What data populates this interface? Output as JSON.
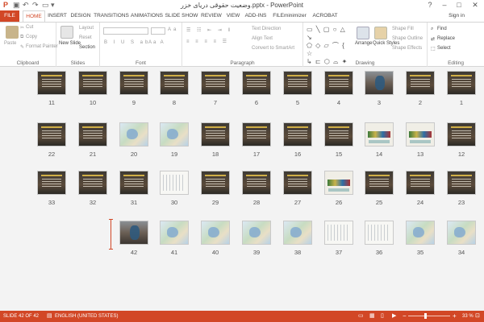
{
  "window": {
    "title": "وضعیت حقوقی دریای خزر.pptx - PowerPoint",
    "signin": "Sign in",
    "help": "?",
    "minimize": "–",
    "maximize": "□",
    "close": "✕"
  },
  "tabs": [
    "FILE",
    "HOME",
    "INSERT",
    "DESIGN",
    "TRANSITIONS",
    "ANIMATIONS",
    "SLIDE SHOW",
    "REVIEW",
    "VIEW",
    "ADD-INS",
    "FILEminimizer",
    "ACROBAT"
  ],
  "active_tab": "HOME",
  "ribbon": {
    "clipboard": {
      "label": "Clipboard",
      "paste": "Paste",
      "cut": "Cut",
      "copy": "Copy",
      "format_painter": "Format Painter"
    },
    "slides": {
      "label": "Slides",
      "new_slide": "New Slide",
      "layout": "Layout",
      "reset": "Reset",
      "section": "Section"
    },
    "font": {
      "label": "Font"
    },
    "paragraph": {
      "label": "Paragraph",
      "text_direction": "Text Direction",
      "align_text": "Align Text",
      "convert_smartart": "Convert to SmartArt"
    },
    "drawing": {
      "label": "Drawing",
      "arrange": "Arrange",
      "quick_styles": "Quick Styles",
      "shape_fill": "Shape Fill",
      "shape_outline": "Shape Outline",
      "shape_effects": "Shape Effects"
    },
    "editing": {
      "label": "Editing",
      "find": "Find",
      "replace": "Replace",
      "select": "Select"
    }
  },
  "slides": [
    {
      "n": "1",
      "kind": "dark"
    },
    {
      "n": "2",
      "kind": "dark"
    },
    {
      "n": "3",
      "kind": "photo"
    },
    {
      "n": "4",
      "kind": "dark"
    },
    {
      "n": "5",
      "kind": "dark"
    },
    {
      "n": "6",
      "kind": "dark"
    },
    {
      "n": "7",
      "kind": "dark"
    },
    {
      "n": "8",
      "kind": "dark"
    },
    {
      "n": "9",
      "kind": "dark"
    },
    {
      "n": "10",
      "kind": "dark"
    },
    {
      "n": "11",
      "kind": "dark"
    },
    {
      "n": "12",
      "kind": "dark"
    },
    {
      "n": "13",
      "kind": "chart"
    },
    {
      "n": "14",
      "kind": "chart"
    },
    {
      "n": "15",
      "kind": "dark"
    },
    {
      "n": "16",
      "kind": "dark"
    },
    {
      "n": "17",
      "kind": "dark"
    },
    {
      "n": "18",
      "kind": "dark"
    },
    {
      "n": "19",
      "kind": "map"
    },
    {
      "n": "20",
      "kind": "map"
    },
    {
      "n": "21",
      "kind": "dark"
    },
    {
      "n": "22",
      "kind": "dark"
    },
    {
      "n": "23",
      "kind": "dark"
    },
    {
      "n": "24",
      "kind": "dark"
    },
    {
      "n": "25",
      "kind": "dark"
    },
    {
      "n": "26",
      "kind": "chart"
    },
    {
      "n": "27",
      "kind": "dark"
    },
    {
      "n": "28",
      "kind": "dark"
    },
    {
      "n": "29",
      "kind": "dark"
    },
    {
      "n": "30",
      "kind": "white"
    },
    {
      "n": "31",
      "kind": "dark"
    },
    {
      "n": "32",
      "kind": "dark"
    },
    {
      "n": "33",
      "kind": "dark"
    },
    {
      "n": "34",
      "kind": "map"
    },
    {
      "n": "35",
      "kind": "map"
    },
    {
      "n": "36",
      "kind": "white"
    },
    {
      "n": "37",
      "kind": "white"
    },
    {
      "n": "38",
      "kind": "map"
    },
    {
      "n": "39",
      "kind": "map"
    },
    {
      "n": "40",
      "kind": "map"
    },
    {
      "n": "41",
      "kind": "map"
    },
    {
      "n": "42",
      "kind": "photo"
    }
  ],
  "status": {
    "slide": "SLIDE 42 OF 42",
    "language": "ENGLISH (UNITED STATES)",
    "zoom": "33 %",
    "zoom_minus": "−",
    "zoom_plus": "+"
  },
  "colors": {
    "accent": "#d24726",
    "status_bar": "#d24726",
    "workspace": "#f3f3f3"
  }
}
